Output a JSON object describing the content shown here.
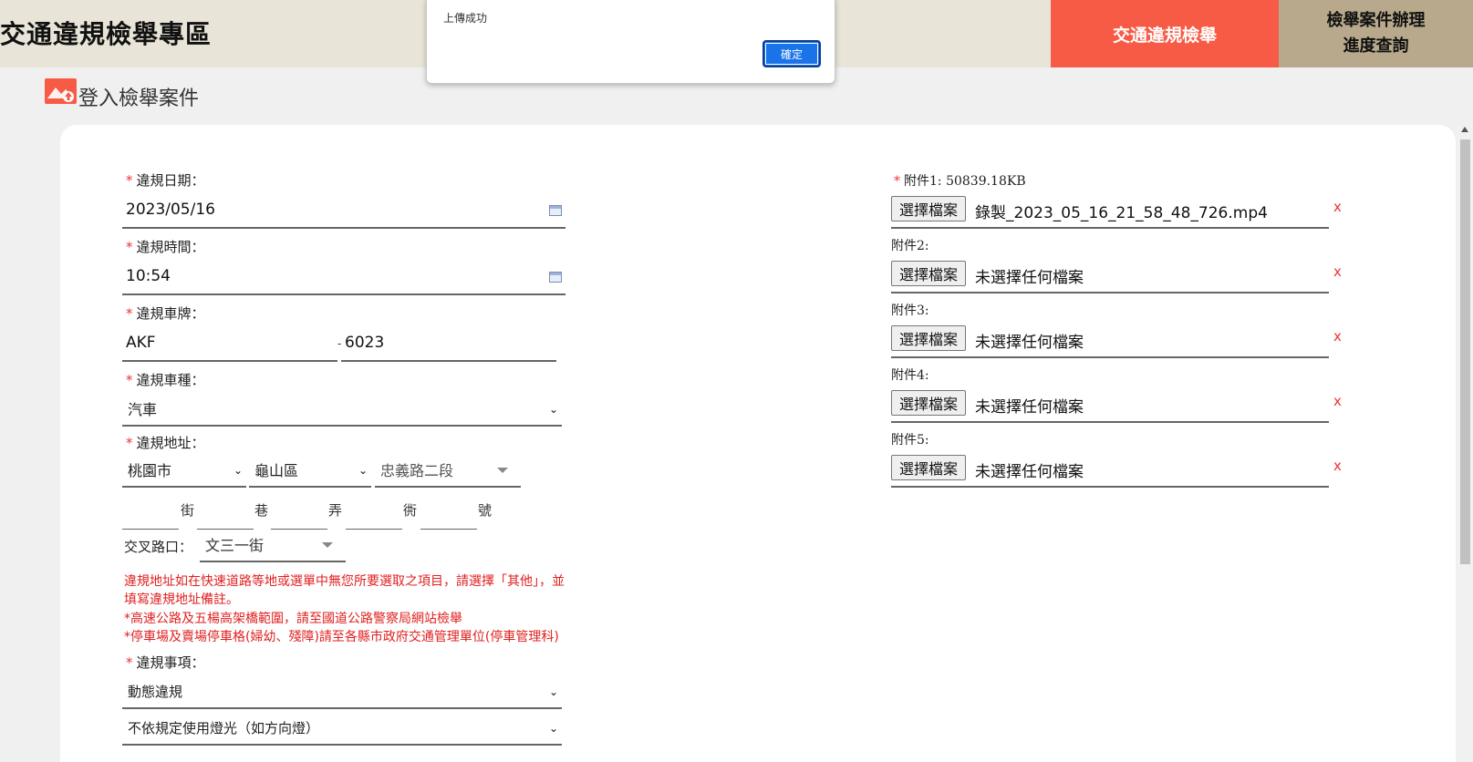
{
  "header": {
    "site_title": "交通違規檢舉專區",
    "nav_report": "交通違規檢舉",
    "nav_progress_line1": "檢舉案件辦理",
    "nav_progress_line2": "進度查詢"
  },
  "dialog": {
    "message": "上傳成功",
    "ok_label": "確定"
  },
  "section": {
    "title": "登入檢舉案件"
  },
  "form": {
    "date": {
      "label": "違規日期：",
      "value": "2023/05/16"
    },
    "time": {
      "label": "違規時間：",
      "value": "10:54"
    },
    "plate": {
      "label": "違規車牌：",
      "part1": "AKF",
      "separator": "-",
      "part2": "6023"
    },
    "vehicle": {
      "label": "違規車種：",
      "value": "汽車"
    },
    "address": {
      "label": "違規地址：",
      "city": "桃園市",
      "district": "龜山區",
      "road": "忠義路二段",
      "units": [
        "街",
        "巷",
        "弄",
        "衖",
        "號"
      ],
      "intersection_label": "交叉路口：",
      "intersection_value": "文三一街"
    },
    "notices": [
      "違規地址如在快速道路等地或選單中無您所要選取之項目，請選擇「其他」，並",
      "填寫違規地址備註。",
      "*高速公路及五楊高架橋範圍，請至國道公路警察局網站檢舉",
      "*停車場及賣場停車格(婦幼、殘障)請至各縣市政府交通管理單位(停車管理科)"
    ],
    "violation": {
      "label": "違規事項：",
      "category": "動態違規",
      "item": "不依規定使用燈光（如方向燈）"
    },
    "required_mark": "*"
  },
  "attachments": {
    "choose_label": "選擇檔案",
    "remove_label": "x",
    "items": [
      {
        "label": "附件1: 50839.18KB",
        "file": "錄製_2023_05_16_21_58_48_726.mp4",
        "required": true
      },
      {
        "label": "附件2:",
        "file": "未選擇任何檔案",
        "required": false
      },
      {
        "label": "附件3:",
        "file": "未選擇任何檔案",
        "required": false
      },
      {
        "label": "附件4:",
        "file": "未選擇任何檔案",
        "required": false
      },
      {
        "label": "附件5:",
        "file": "未選擇任何檔案",
        "required": false
      }
    ]
  },
  "colors": {
    "header_bg": "#e8e4d8",
    "nav_report_bg": "#f75b45",
    "nav_progress_bg": "#b9a98c",
    "required": "#e33333",
    "notice": "#e02020",
    "dialog_button": "#1a73e8"
  },
  "icons": {
    "section": "upload-image-icon",
    "calendar": "calendar-icon",
    "dropdown": "chevron-down-icon"
  }
}
